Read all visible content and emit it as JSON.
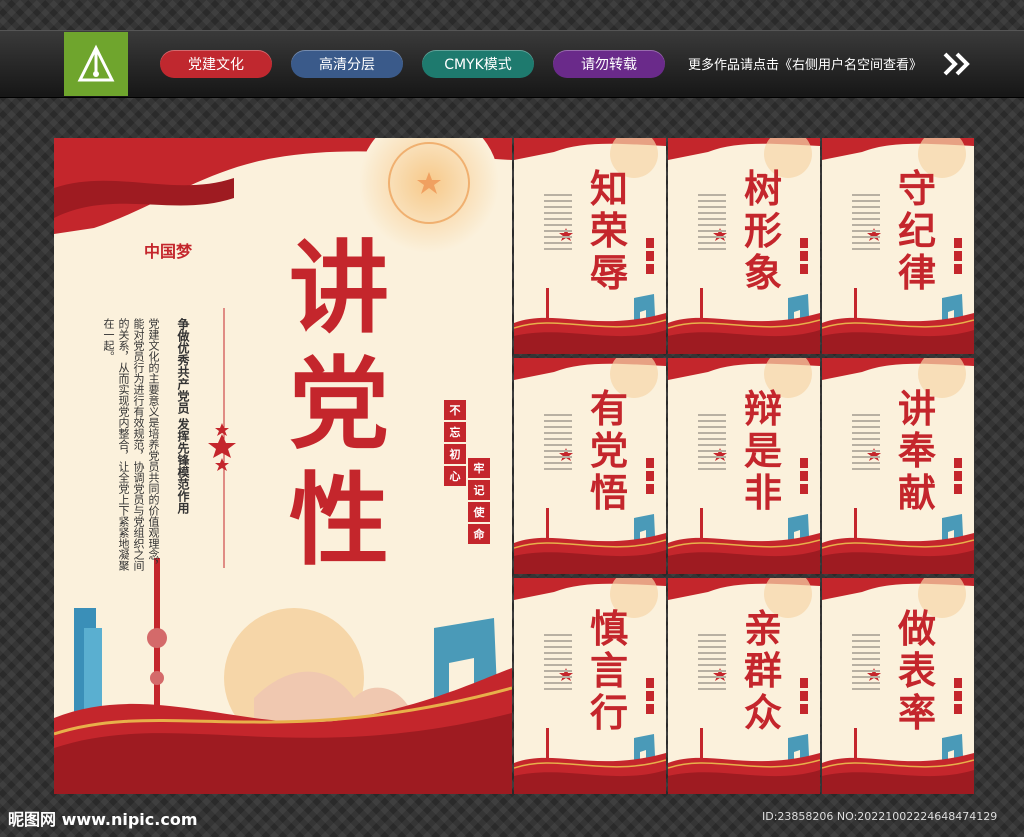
{
  "tags": [
    {
      "label": "党建文化",
      "color": "#c0282f"
    },
    {
      "label": "高清分层",
      "color": "#3a5a8a"
    },
    {
      "label": "CMYK模式",
      "color": "#1e7a6e"
    },
    {
      "label": "请勿转载",
      "color": "#6a2a8a"
    }
  ],
  "more_text": "更多作品请点击《右侧用户名空间查看》",
  "main": {
    "title": "讲党性",
    "slogan": "争做优秀共产党员 发挥先锋模范作用",
    "body": "党建文化的主要意义是培养党员共同的价值观理念，能对党员行为进行有效规范，协调党员与党组织之间的关系，从而实现党内整合，让全党上下紧紧地凝聚在一起。",
    "seal_1": [
      "不",
      "忘",
      "初",
      "心"
    ],
    "seal_2": [
      "牢",
      "记",
      "使",
      "命"
    ]
  },
  "panels": [
    {
      "title": "知荣辱"
    },
    {
      "title": "树形象"
    },
    {
      "title": "守纪律"
    },
    {
      "title": "有党悟"
    },
    {
      "title": "辩是非"
    },
    {
      "title": "讲奉献"
    },
    {
      "title": "慎言行"
    },
    {
      "title": "亲群众"
    },
    {
      "title": "做表率"
    }
  ],
  "footer_left": "昵图网 www.nipic.com",
  "footer_right": "ID:23858206 NO:20221002224648474129",
  "colors": {
    "red": "#c4262c",
    "cream": "#fbf1dc",
    "gold": "#e8b04a"
  }
}
